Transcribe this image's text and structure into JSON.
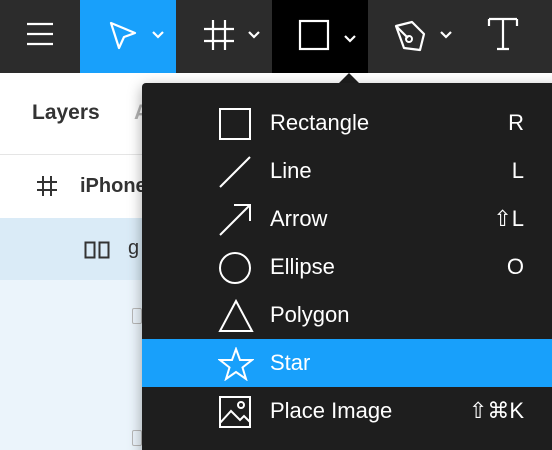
{
  "toolbar": {
    "tools": [
      {
        "name": "main-menu",
        "icon": "hamburger-icon"
      },
      {
        "name": "move",
        "icon": "cursor-arrow-icon",
        "active": true
      },
      {
        "name": "frame",
        "icon": "frame-hash-icon"
      },
      {
        "name": "shape",
        "icon": "rectangle-icon",
        "open": true
      },
      {
        "name": "pen",
        "icon": "pen-nib-icon"
      },
      {
        "name": "text",
        "icon": "text-t-icon"
      }
    ],
    "active_color": "#18a0fb",
    "background_color": "#2c2c2c"
  },
  "panel": {
    "tabs": {
      "layers": "Layers",
      "assets": "A"
    },
    "frame_row": {
      "icon": "frame-hash-icon",
      "label": "iPhone"
    },
    "group_row": {
      "icon": "group-icon",
      "label": "g"
    },
    "selected_row_color": "#daebf7"
  },
  "shape_menu": {
    "items": [
      {
        "label": "Rectangle",
        "shortcut": "R",
        "icon": "rectangle-icon"
      },
      {
        "label": "Line",
        "shortcut": "L",
        "icon": "line-icon"
      },
      {
        "label": "Arrow",
        "shortcut": "⇧L",
        "icon": "arrow-icon"
      },
      {
        "label": "Ellipse",
        "shortcut": "O",
        "icon": "ellipse-icon"
      },
      {
        "label": "Polygon",
        "shortcut": "",
        "icon": "polygon-icon"
      },
      {
        "label": "Star",
        "shortcut": "",
        "icon": "star-icon",
        "highlighted": true
      },
      {
        "label": "Place Image",
        "shortcut": "⇧⌘K",
        "icon": "image-icon"
      }
    ],
    "background_color": "#1e1e1e",
    "highlight_color": "#18a0fb"
  }
}
